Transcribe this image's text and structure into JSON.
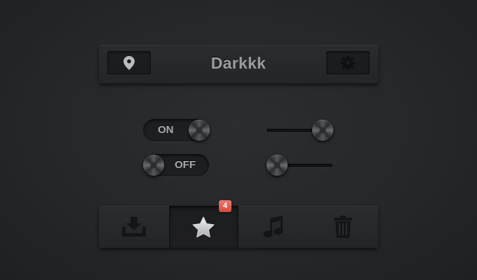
{
  "header": {
    "title": "Darkkk",
    "left_icon": "location-pin-icon",
    "right_icon": "gear-icon"
  },
  "toggles": [
    {
      "label": "ON",
      "state": "on"
    },
    {
      "label": "OFF",
      "state": "off"
    }
  ],
  "sliders": [
    {
      "value": 1.0
    },
    {
      "value": 0.0
    }
  ],
  "tabbar": {
    "tabs": [
      {
        "icon": "download-icon",
        "active": false
      },
      {
        "icon": "star-icon",
        "active": true,
        "badge": "4"
      },
      {
        "icon": "music-note-icon",
        "active": false
      },
      {
        "icon": "trash-icon",
        "active": false
      }
    ]
  },
  "colors": {
    "background": "#25272a",
    "badge": "#e0584a",
    "text": "#9a9c9f"
  }
}
